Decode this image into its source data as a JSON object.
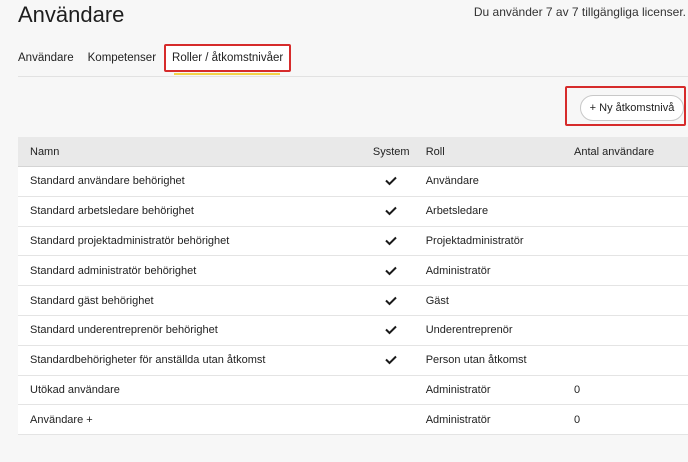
{
  "header": {
    "title": "Användare",
    "license": "Du använder 7 av 7 tillgängliga licenser."
  },
  "tabs": [
    {
      "label": "Användare",
      "active": false
    },
    {
      "label": "Kompetenser",
      "active": false
    },
    {
      "label": "Roller / åtkomstnivåer",
      "active": true
    }
  ],
  "toolbar": {
    "new_access_label": "+ Ny åtkomstnivå"
  },
  "table": {
    "columns": [
      "Namn",
      "System",
      "Roll",
      "Antal användare"
    ],
    "rows": [
      {
        "name": "Standard användare behörighet",
        "system": true,
        "role": "Användare",
        "count": ""
      },
      {
        "name": "Standard arbetsledare behörighet",
        "system": true,
        "role": "Arbetsledare",
        "count": ""
      },
      {
        "name": "Standard projektadministratör behörighet",
        "system": true,
        "role": "Projektadministratör",
        "count": ""
      },
      {
        "name": "Standard administratör behörighet",
        "system": true,
        "role": "Administratör",
        "count": ""
      },
      {
        "name": "Standard gäst behörighet",
        "system": true,
        "role": "Gäst",
        "count": ""
      },
      {
        "name": "Standard underentreprenör behörighet",
        "system": true,
        "role": "Underentreprenör",
        "count": ""
      },
      {
        "name": "Standardbehörigheter för anställda utan åtkomst",
        "system": true,
        "role": "Person utan åtkomst",
        "count": ""
      },
      {
        "name": "Utökad användare",
        "system": false,
        "role": "Administratör",
        "count": "0"
      },
      {
        "name": "Användare +",
        "system": false,
        "role": "Administratör",
        "count": "0"
      }
    ]
  },
  "colors": {
    "highlight": "#d62b2b",
    "tab_underline": "#f3d34a"
  }
}
